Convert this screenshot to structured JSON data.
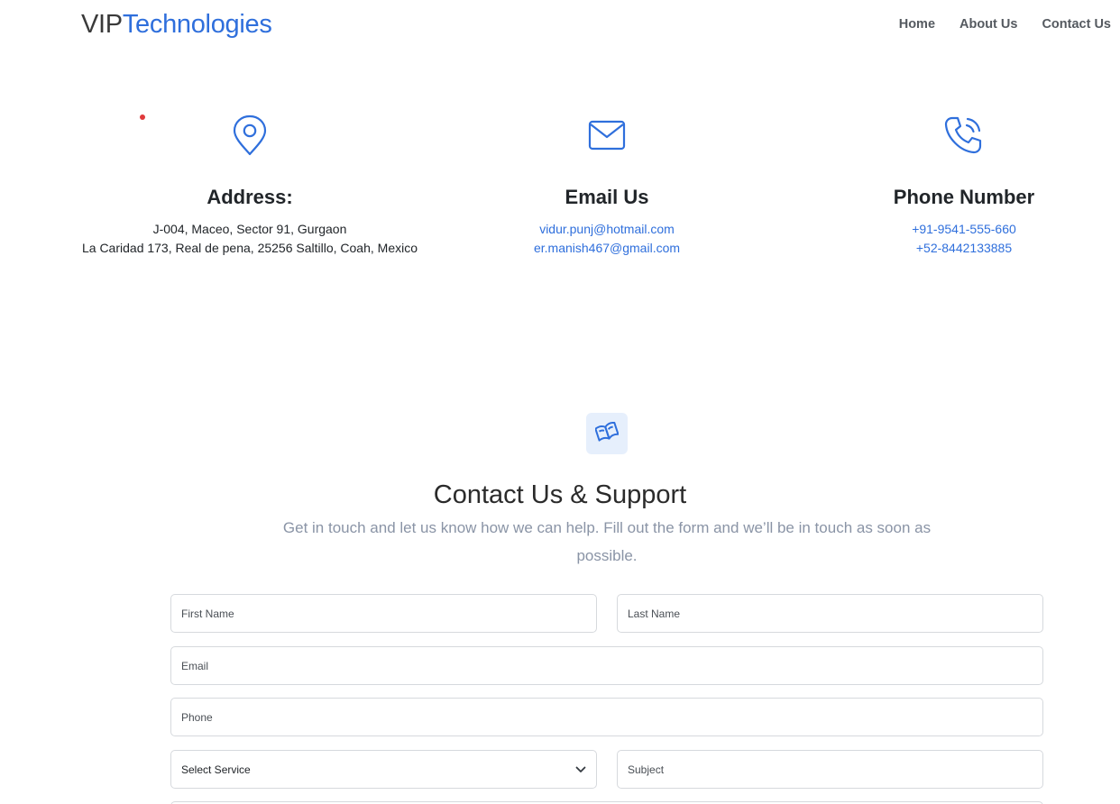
{
  "brand": {
    "part1": "VIP",
    "part2": "Technologies"
  },
  "nav": {
    "home": "Home",
    "about": "About Us",
    "contact": "Contact Us"
  },
  "address": {
    "icon": "map-pin-icon",
    "title": "Address:",
    "line1": "J-004, Maceo, Sector 91, Gurgaon",
    "line2": "La Caridad 173, Real de pena, 25256 Saltillo, Coah, Mexico"
  },
  "email": {
    "icon": "envelope-icon",
    "title": "Email Us",
    "line1": "vidur.punj@hotmail.com",
    "line2": "er.manish467@gmail.com"
  },
  "phone": {
    "icon": "phone-ringing-icon",
    "title": "Phone Number",
    "line1": "+91-9541-555-660",
    "line2": "+52-8442133885"
  },
  "contact": {
    "icon": "book-icon",
    "title": "Contact Us & Support",
    "subtitle": "Get in touch and let us know how we can help. Fill out the form and we’ll be in touch as soon as possible."
  },
  "form": {
    "first_name_placeholder": "First Name",
    "last_name_placeholder": "Last Name",
    "email_placeholder": "Email",
    "phone_placeholder": "Phone",
    "service_selected": "Select Service",
    "subject_placeholder": "Subject"
  },
  "colors": {
    "accent": "#2f6fdc",
    "muted": "#8a94a6",
    "badge_bg": "#e6effc"
  }
}
